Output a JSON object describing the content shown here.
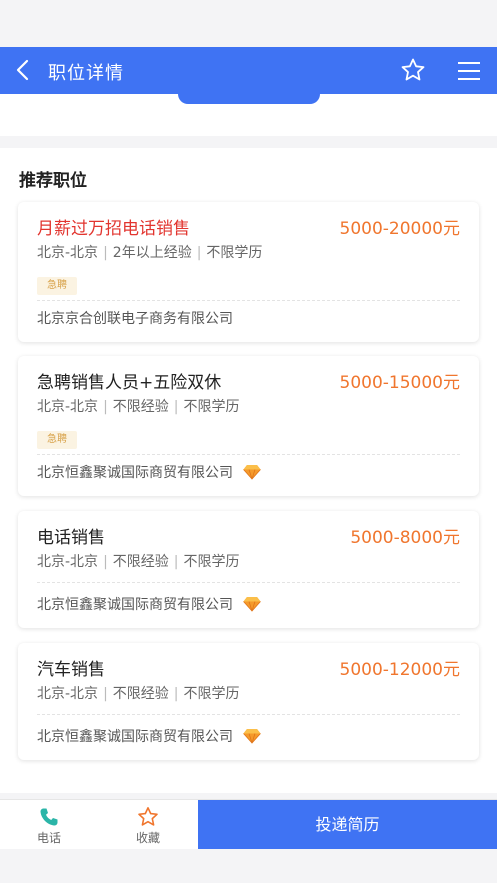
{
  "header": {
    "title": "职位详情"
  },
  "section": {
    "title": "推荐职位"
  },
  "jobs": [
    {
      "title": "月薪过万招电话销售",
      "salary": "5000-20000元",
      "location": "北京-北京",
      "experience": "2年以上经验",
      "education": "不限学历",
      "badge": "急聘",
      "company": "北京京合创联电子商务有限公司"
    },
    {
      "title": "急聘销售人员+五险双休",
      "salary": "5000-15000元",
      "location": "北京-北京",
      "experience": "不限经验",
      "education": "不限学历",
      "badge": "急聘",
      "company": "北京恒鑫聚诚国际商贸有限公司"
    },
    {
      "title": "电话销售",
      "salary": "5000-8000元",
      "location": "北京-北京",
      "experience": "不限经验",
      "education": "不限学历",
      "company": "北京恒鑫聚诚国际商贸有限公司"
    },
    {
      "title": "汽车销售",
      "salary": "5000-12000元",
      "location": "北京-北京",
      "experience": "不限经验",
      "education": "不限学历",
      "company": "北京恒鑫聚诚国际商贸有限公司"
    }
  ],
  "bottom_bar": {
    "phone_label": "电话",
    "favorite_label": "收藏",
    "submit_label": "投递简历"
  },
  "colors": {
    "primary": "#3f73f3",
    "salary": "#f0762e",
    "highlight_title": "#e2352f",
    "badge_text": "#d8a24a"
  }
}
